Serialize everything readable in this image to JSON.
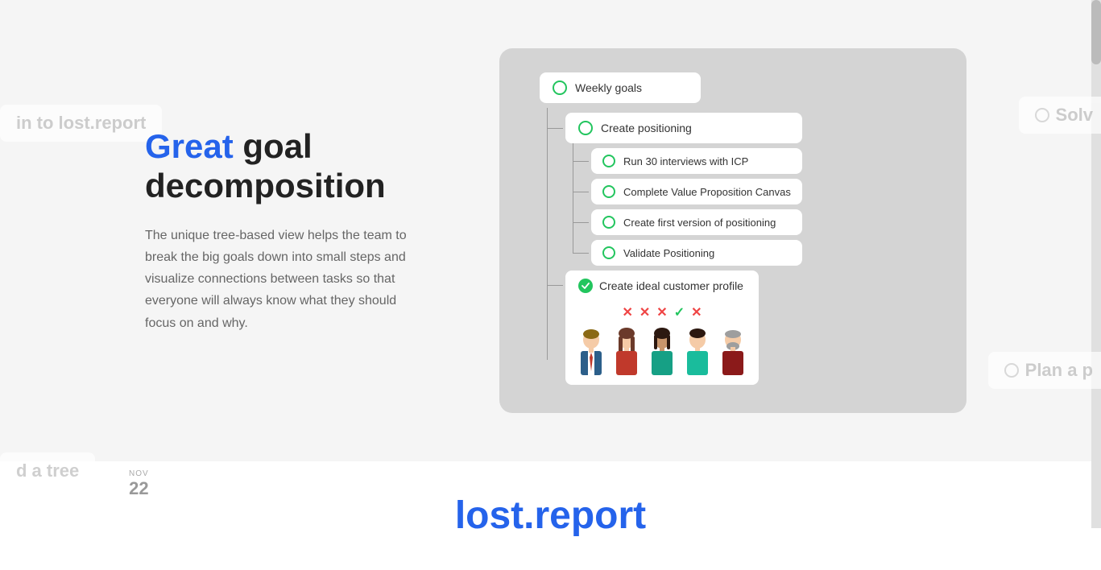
{
  "page": {
    "background_color": "#f5f5f5"
  },
  "left_content": {
    "headline_blue": "Great",
    "headline_rest": " goal decomposition",
    "description": "The unique tree-based view helps the team to break the big goals down into small steps and visualize connections between tasks so that everyone will always know what they should focus on and why."
  },
  "float_labels": {
    "left_top": "in to lost.report",
    "left_bottom": "d a tree",
    "date_month": "NOV",
    "date_day": "22",
    "right_top": "Solv",
    "right_bottom": "Plan a p"
  },
  "tree": {
    "root": {
      "label": "Weekly goals",
      "circle": "outline-green"
    },
    "level1": [
      {
        "label": "Create positioning",
        "circle": "outline-green",
        "children": [
          {
            "label": "Run 30 interviews with ICP",
            "circle": "outline-green"
          },
          {
            "label": "Complete Value Proposition Canvas",
            "circle": "outline-green"
          },
          {
            "label": "Create first version of positioning",
            "circle": "outline-green"
          },
          {
            "label": "Validate Positioning",
            "circle": "outline-green"
          }
        ]
      },
      {
        "label": "Create ideal customer profile",
        "circle": "filled-green",
        "expanded": true,
        "votes": [
          "x",
          "x",
          "x",
          "check",
          "x"
        ],
        "vote_colors": [
          "red",
          "red",
          "red",
          "green",
          "red"
        ]
      }
    ]
  },
  "bottom": {
    "brand": "lost.report"
  }
}
